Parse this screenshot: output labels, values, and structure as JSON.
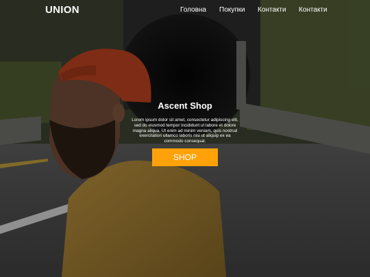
{
  "header": {
    "logo": "UNION",
    "nav": [
      "Головна",
      "Покупки",
      "Контакти",
      "Контакти"
    ]
  },
  "hero": {
    "title": "Ascent Shop",
    "text": "Lorem ipsum dolor sit amet, consectetur adipiscing elit, sed do eiusmod tempor incididunt ut labore et dolore magna aliqua. Ut enim ad minim veniam, quis nostrud exercitation ullamco laboris nisi ut aliquip ex ea commodo consequat.",
    "button_label": "SHOP"
  },
  "colors": {
    "accent": "#ffa20a",
    "text": "#ffffff"
  }
}
